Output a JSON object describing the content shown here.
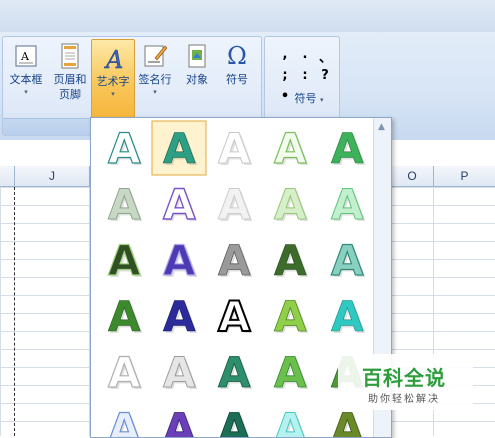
{
  "ribbon": {
    "text_box": "文本框",
    "header_footer_1": "页眉和",
    "header_footer_2": "页脚",
    "wordart": "艺术字",
    "signature": "签名行",
    "object": "对象",
    "symbol": "符号",
    "special_symbol": "符号",
    "symbol_glyph": "Ω",
    "special_symbol_glyphs": [
      ",",
      ".",
      "、",
      ";",
      ":",
      "?",
      "•"
    ],
    "dropdown_caret": "▾"
  },
  "columns": [
    "J",
    "O",
    "P"
  ],
  "wordart_gallery": {
    "letter": "A",
    "selected_index": 1,
    "styles": [
      [
        "outline-teal",
        "teal-glow",
        "white-shadow",
        "outline-green",
        "green-gradient"
      ],
      [
        "soft-gray-green",
        "purple-outline",
        "faint-gray",
        "light-green",
        "light-green-glow"
      ],
      [
        "dark-green-glow",
        "purple-blue",
        "gray-bevel",
        "dark-green",
        "teal-3d"
      ],
      [
        "green-solid",
        "navy-solid",
        "black-white",
        "lime",
        "cyan-reflect"
      ],
      [
        "silver-outline",
        "silver-3d",
        "teal-dark-3d",
        "green-gradient-2",
        "green-partial"
      ],
      [
        "blue-outline",
        "purple-3d",
        "dark-teal",
        "cyan-light",
        "olive"
      ]
    ]
  },
  "colors": {
    "ribbon_bg": "#d6e4f5",
    "selected_button": "#f8c75a",
    "gallery_border": "#8ca7c9"
  },
  "watermark": {
    "logo": "百科全说",
    "tagline": "助你轻松解决"
  }
}
